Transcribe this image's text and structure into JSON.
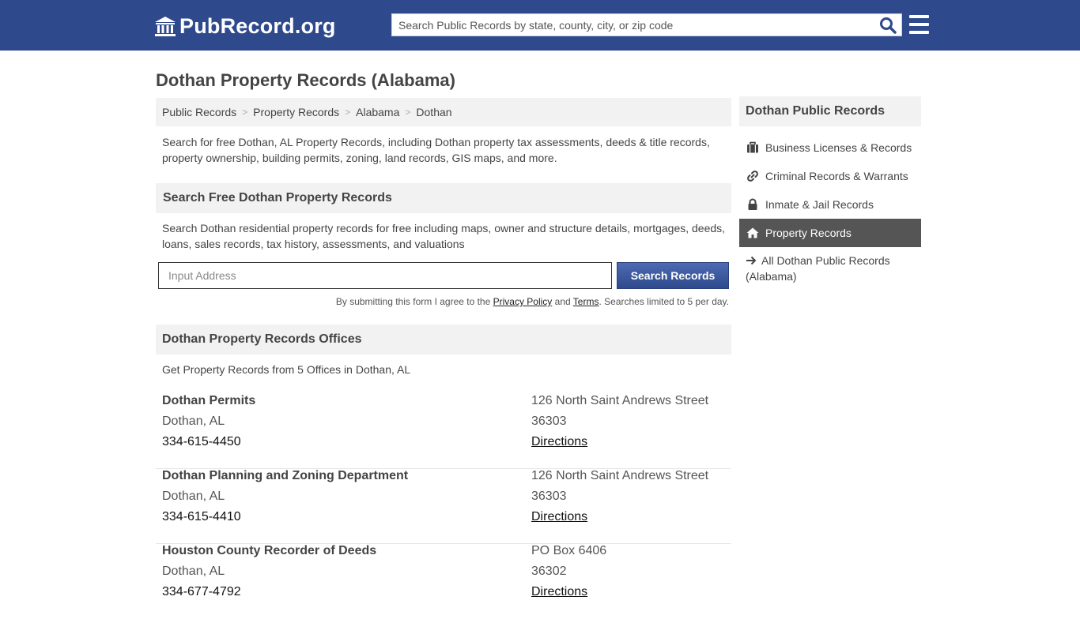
{
  "header": {
    "logo_text": "PubRecord.org",
    "search_placeholder": "Search Public Records by state, county, city, or zip code",
    "brand_color": "#2f4a8c"
  },
  "page": {
    "title": "Dothan Property Records (Alabama)"
  },
  "breadcrumb": [
    "Public Records",
    "Property Records",
    "Alabama",
    "Dothan"
  ],
  "intro": "Search for free Dothan, AL Property Records, including Dothan property tax assessments, deeds & title records, property ownership, building permits, zoning, land records, GIS maps, and more.",
  "search_section": {
    "heading": "Search Free Dothan Property Records",
    "description": "Search Dothan residential property records for free including maps, owner and structure details, mortgages, deeds, loans, sales records, tax history, assessments, and valuations",
    "input_placeholder": "Input Address",
    "button_label": "Search Records",
    "disclaimer_prefix": "By submitting this form I agree to the ",
    "privacy_link": "Privacy Policy",
    "and_text": " and ",
    "terms_link": "Terms",
    "disclaimer_suffix": ". Searches limited to 5 per day."
  },
  "offices_section": {
    "heading": "Dothan Property Records Offices",
    "subheading": "Get Property Records from 5 Offices in Dothan, AL",
    "offices": [
      {
        "name": "Dothan Permits",
        "city": "Dothan, AL",
        "phone": "334-615-4450",
        "street": "126 North Saint Andrews Street",
        "zip": "36303",
        "directions": "Directions"
      },
      {
        "name": "Dothan Planning and Zoning Department",
        "city": "Dothan, AL",
        "phone": "334-615-4410",
        "street": "126 North Saint Andrews Street",
        "zip": "36303",
        "directions": "Directions"
      },
      {
        "name": "Houston County Recorder of Deeds",
        "city": "Dothan, AL",
        "phone": "334-677-4792",
        "street": "PO Box 6406",
        "zip": "36302",
        "directions": "Directions"
      }
    ]
  },
  "sidebar": {
    "heading": "Dothan Public Records",
    "items": [
      {
        "label": "Business Licenses & Records",
        "icon": "briefcase-icon"
      },
      {
        "label": "Criminal Records & Warrants",
        "icon": "link-icon"
      },
      {
        "label": "Inmate & Jail Records",
        "icon": "lock-icon"
      },
      {
        "label": "Property Records",
        "icon": "home-icon",
        "active": true
      },
      {
        "label": "All Dothan Public Records (Alabama)",
        "icon": "arrow-right-icon"
      }
    ],
    "active_color": "#555555"
  }
}
